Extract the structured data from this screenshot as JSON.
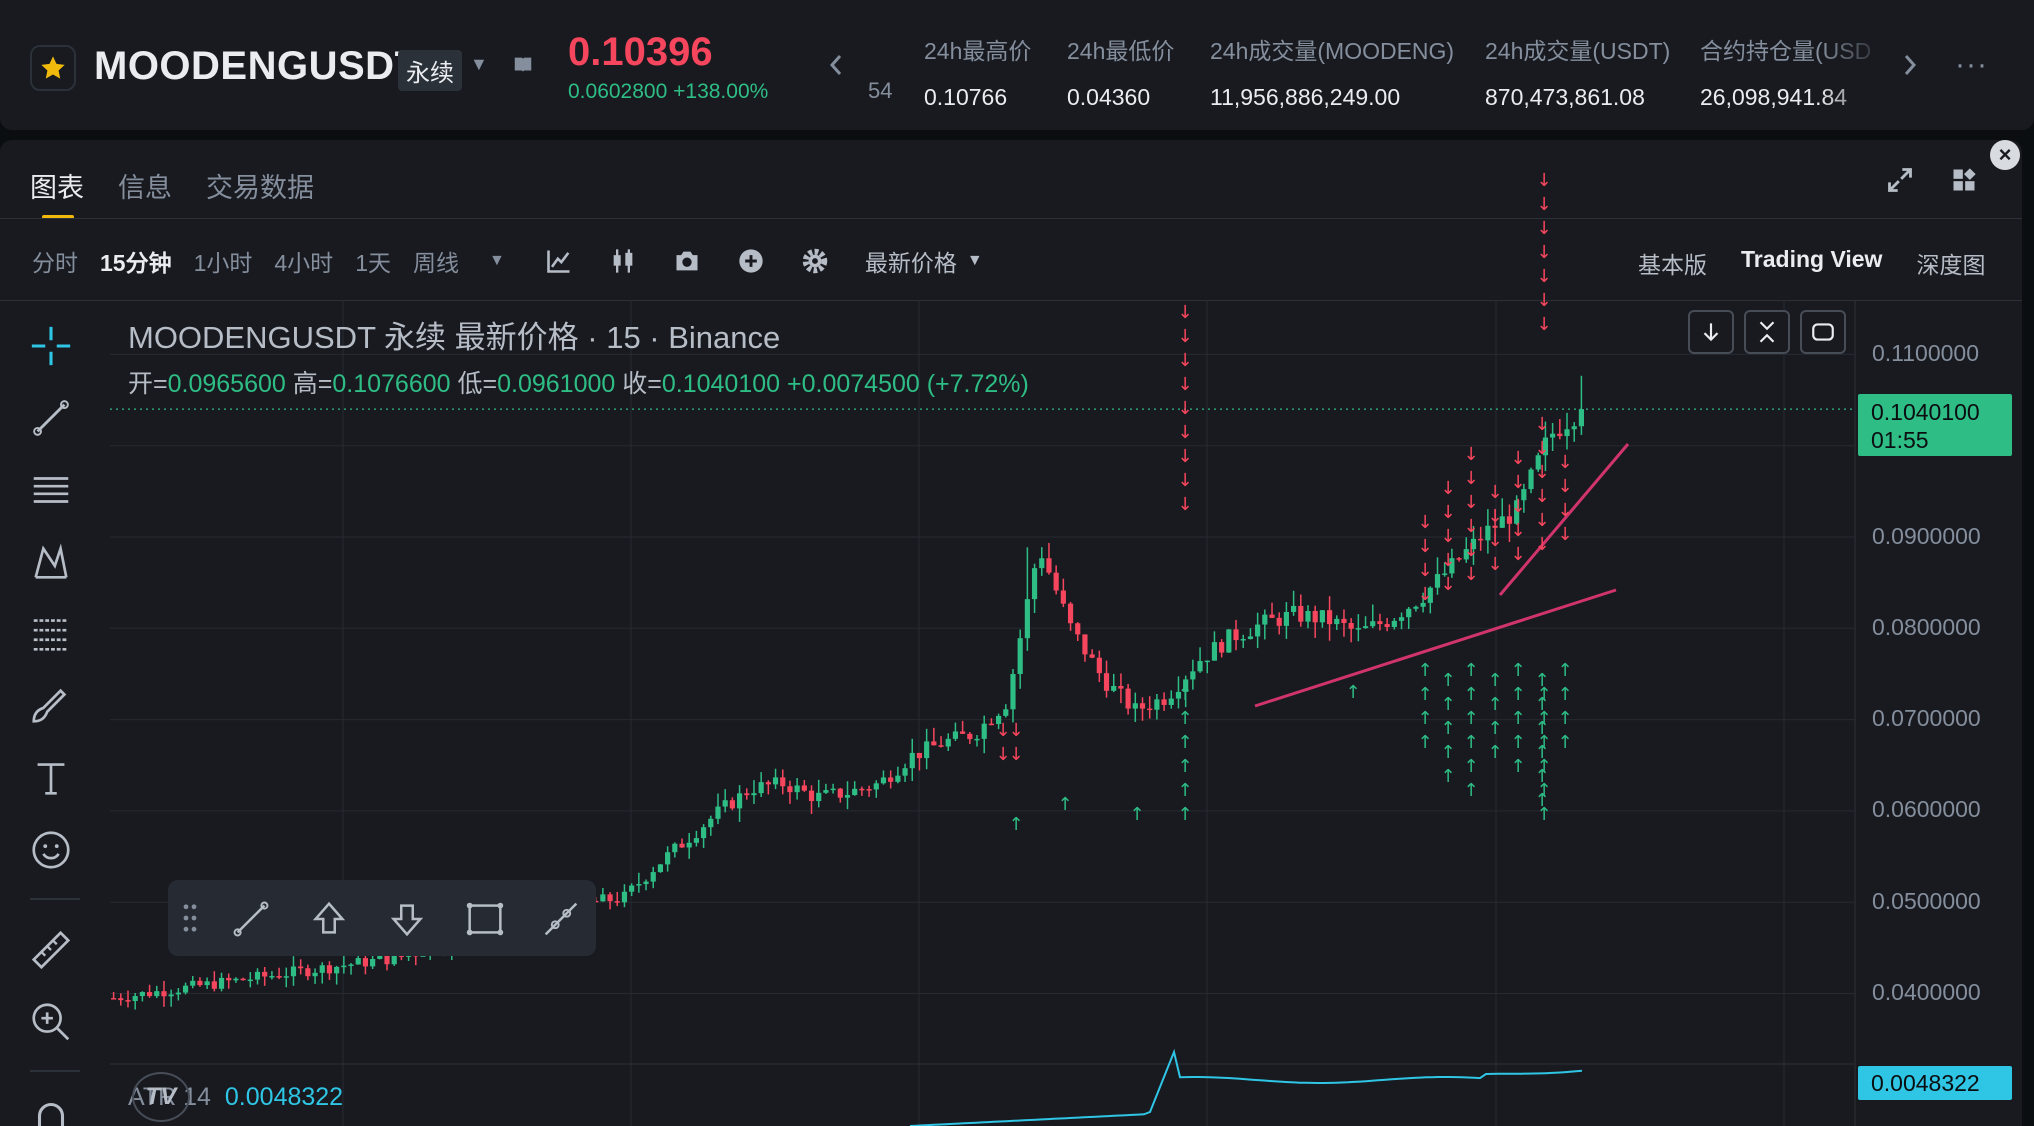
{
  "header": {
    "symbol": "MOODENGUSDT",
    "contract_type": "永续",
    "last_price": "0.10396",
    "change_abs": "0.0602800",
    "change_pct": "+138.00%",
    "partial_stat": "54",
    "stats": [
      {
        "label": "24h最高价",
        "value": "0.10766"
      },
      {
        "label": "24h最低价",
        "value": "0.04360"
      },
      {
        "label": "24h成交量(MOODENG)",
        "value": "11,956,886,249.00"
      },
      {
        "label": "24h成交量(USDT)",
        "value": "870,473,861.08"
      },
      {
        "label": "合约持仓量(USD",
        "value": "26,098,941.84"
      }
    ]
  },
  "tabs": [
    "图表",
    "信息",
    "交易数据"
  ],
  "toolbar": {
    "intervals": [
      "分时",
      "15分钟",
      "1小时",
      "4小时",
      "1天",
      "周线"
    ],
    "active_interval": "15分钟",
    "price_type": "最新价格",
    "views": [
      "基本版",
      "Trading View",
      "深度图"
    ],
    "active_view": "Trading View"
  },
  "legend": {
    "title": "MOODENGUSDT 永续 最新价格 · 15 · Binance",
    "open_label": "开=",
    "open": "0.0965600",
    "high_label": "高=",
    "high": "0.1076600",
    "low_label": "低=",
    "low": "0.0961000",
    "close_label": "收=",
    "close": "0.1040100",
    "change": "+0.0074500 (+7.72%)"
  },
  "price_axis": {
    "ticks": [
      "0.1100000",
      "0.0900000",
      "0.0800000",
      "0.0700000",
      "0.0600000",
      "0.0500000",
      "0.0400000"
    ],
    "current_price": "0.1040100",
    "countdown": "01:55"
  },
  "indicator": {
    "name": "ATR 14",
    "value": "0.0048322"
  },
  "colors": {
    "up": "#2ebd85",
    "down": "#f6465d",
    "accent": "#f0b90b",
    "trendline": "#d1346b",
    "atr": "#2fc6e5"
  },
  "chart_data": {
    "type": "candlestick",
    "interval": "15",
    "y_ticks": [
      0.11,
      0.09,
      0.08,
      0.07,
      0.06,
      0.05,
      0.04
    ],
    "last_close": 0.10401,
    "approx_closes": [
      0.0395,
      0.04,
      0.0405,
      0.041,
      0.0415,
      0.042,
      0.0425,
      0.043,
      0.0435,
      0.044,
      0.045,
      0.0465,
      0.047,
      0.048,
      0.049,
      0.05,
      0.0505,
      0.054,
      0.057,
      0.06,
      0.0625,
      0.063,
      0.0615,
      0.062,
      0.063,
      0.066,
      0.0675,
      0.0685,
      0.072,
      0.089,
      0.08,
      0.0745,
      0.071,
      0.0725,
      0.0765,
      0.079,
      0.0805,
      0.0815,
      0.081,
      0.0795,
      0.081,
      0.0835,
      0.087,
      0.0905,
      0.093,
      0.1011,
      0.10401
    ]
  }
}
